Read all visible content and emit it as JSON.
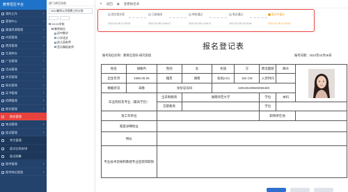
{
  "sidebar": {
    "brand": "教育招生平台",
    "items": [
      {
        "label": "我的工作",
        "sub": false,
        "active": false
      },
      {
        "label": "营销中心",
        "sub": false,
        "active": false
      },
      {
        "label": "渠道资源管理",
        "sub": false,
        "active": false
      },
      {
        "label": "内容管理",
        "sub": false,
        "active": false
      },
      {
        "label": "费用管理",
        "sub": false,
        "active": false
      },
      {
        "label": "生源库存",
        "sub": false,
        "active": false
      },
      {
        "label": "广告管理",
        "sub": false,
        "active": false
      },
      {
        "label": "活动管理",
        "sub": false,
        "active": false
      },
      {
        "label": "学员管理",
        "sub": false,
        "active": false
      },
      {
        "label": "报名管理",
        "sub": false,
        "active": false
      },
      {
        "label": "证书管理",
        "sub": false,
        "active": false
      },
      {
        "label": "招聘管理",
        "sub": false,
        "active": false
      },
      {
        "label": "报名管理",
        "sub": false,
        "active": false
      },
      {
        "label": "报名管理",
        "sub": true,
        "active": true
      },
      {
        "label": "笔试管理",
        "sub": false,
        "active": false
      },
      {
        "label": "面试管理",
        "sub": false,
        "active": false
      },
      {
        "label": "考生管理",
        "sub": true,
        "active": false
      },
      {
        "label": "面试日程安排",
        "sub": true,
        "active": false
      },
      {
        "label": "面试测算",
        "sub": true,
        "active": false
      },
      {
        "label": "报考管理",
        "sub": false,
        "active": false
      },
      {
        "label": "报考岗位管理",
        "sub": false,
        "active": false
      }
    ]
  },
  "panel2": {
    "top": "部门/岗位导航",
    "select": "2022教师公开招聘工作计划",
    "tree": [
      "XXXX学校",
      "教师岗位",
      "初中数学",
      "小学语文",
      "幼儿园老师",
      "音乐舞蹈老师"
    ]
  },
  "toolbar": {
    "back": "返回",
    "title": "查看报名表"
  },
  "progress": {
    "steps": [
      {
        "label": "提交报名表",
        "time": "2022-02-08 12:35:22"
      },
      {
        "label": "已被查阅",
        "time": "2022-02-08 12:56:17"
      },
      {
        "label": "审核通过",
        "time": "2022-02-08 14:36:17"
      },
      {
        "label": "笔试通过",
        "time": "2022-02-08 15:23:46"
      },
      {
        "label": "面试中通过",
        "time": "2022-02-08 16:25:00"
      }
    ]
  },
  "form": {
    "title": "报名登记表",
    "position": "报考岗位名称：教育信息科-研究岗组",
    "date": "报考日期：2022年02月08日",
    "labels": {
      "name": "姓名",
      "gender": "性别",
      "ethnic": "民族",
      "politics": "政治面貌",
      "birth": "出生年月",
      "native": "籍贯",
      "height": "身高(cm)",
      "party_time": "入党时间",
      "marital": "婚姻状况",
      "idcard": "身份证号码",
      "edu": "毕业院校及专业（最高学历）",
      "fulltime": "全日制教育",
      "parttime": "在职教育",
      "degree": "学位",
      "work": "现工作单位",
      "duty": "职称所在地",
      "address": "家庭详细地址",
      "skills": "特长",
      "research": "专业技术资格和教授专业后获得职别"
    },
    "values": {
      "name": "胡雁冉",
      "gender": "女",
      "ethnic": "汉",
      "politics": "群众",
      "birth": "1996.06.05",
      "native": "湖南",
      "height": "152 CM",
      "party_time": "",
      "marital": "未婚",
      "idcard": "43010519960605548X",
      "fulltime_school": "湖南师范大学",
      "fulltime_degree": "本科",
      "parttime_school": "",
      "parttime_degree": "",
      "work": "",
      "duty": "",
      "address": "",
      "skills": "",
      "research": ""
    }
  },
  "colors": {
    "sidebar": "#23426c",
    "active": "#e8423d",
    "highlight": "#e8423d",
    "current_step": "#f0a225"
  }
}
